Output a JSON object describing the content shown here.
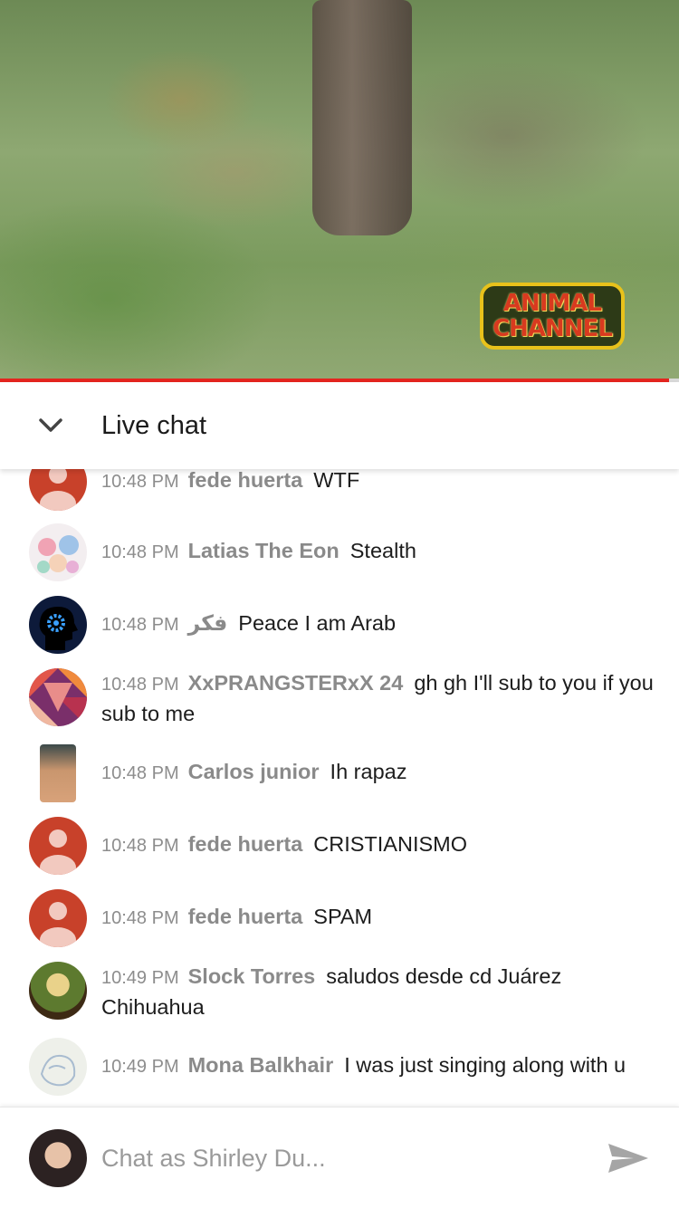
{
  "video": {
    "watermark_line1": "ANIMAL",
    "watermark_line2": "CHANNEL",
    "progress": 0.985,
    "progress_color": "#e4251f"
  },
  "chat": {
    "title": "Live chat",
    "collapse_icon": "chevron-down-icon",
    "messages": [
      {
        "time": "10:48 PM",
        "author": "fede huerta",
        "text": "WTF",
        "avatar": "generic"
      },
      {
        "time": "10:48 PM",
        "author": "Latias The Eon",
        "text": "Stealth",
        "avatar": "anime"
      },
      {
        "time": "10:48 PM",
        "author": "فكر",
        "text": "Peace I am Arab",
        "avatar": "head-gear"
      },
      {
        "time": "10:48 PM",
        "author": "XxPRANGSTERxX 24",
        "text": "gh gh I'll sub to you if you sub to me",
        "avatar": "pattern"
      },
      {
        "time": "10:48 PM",
        "author": "Carlos junior",
        "text": "Ih rapaz",
        "avatar": "photo"
      },
      {
        "time": "10:48 PM",
        "author": "fede huerta",
        "text": "CRISTIANISMO",
        "avatar": "generic"
      },
      {
        "time": "10:48 PM",
        "author": "fede huerta",
        "text": "SPAM",
        "avatar": "generic"
      },
      {
        "time": "10:49 PM",
        "author": "Slock Torres",
        "text": "saludos desde cd Juárez Chihuahua",
        "avatar": "saint"
      },
      {
        "time": "10:49 PM",
        "author": "Mona Balkhair",
        "text": "I was just singing along with u",
        "avatar": "sketch"
      }
    ]
  },
  "composer": {
    "placeholder": "Chat as Shirley Du...",
    "send_icon": "send-icon"
  },
  "colors": {
    "accent": "#e4251f",
    "generic_avatar": "#c8412a",
    "author": "#8a8a8a",
    "timestamp": "#8d8d8d"
  }
}
